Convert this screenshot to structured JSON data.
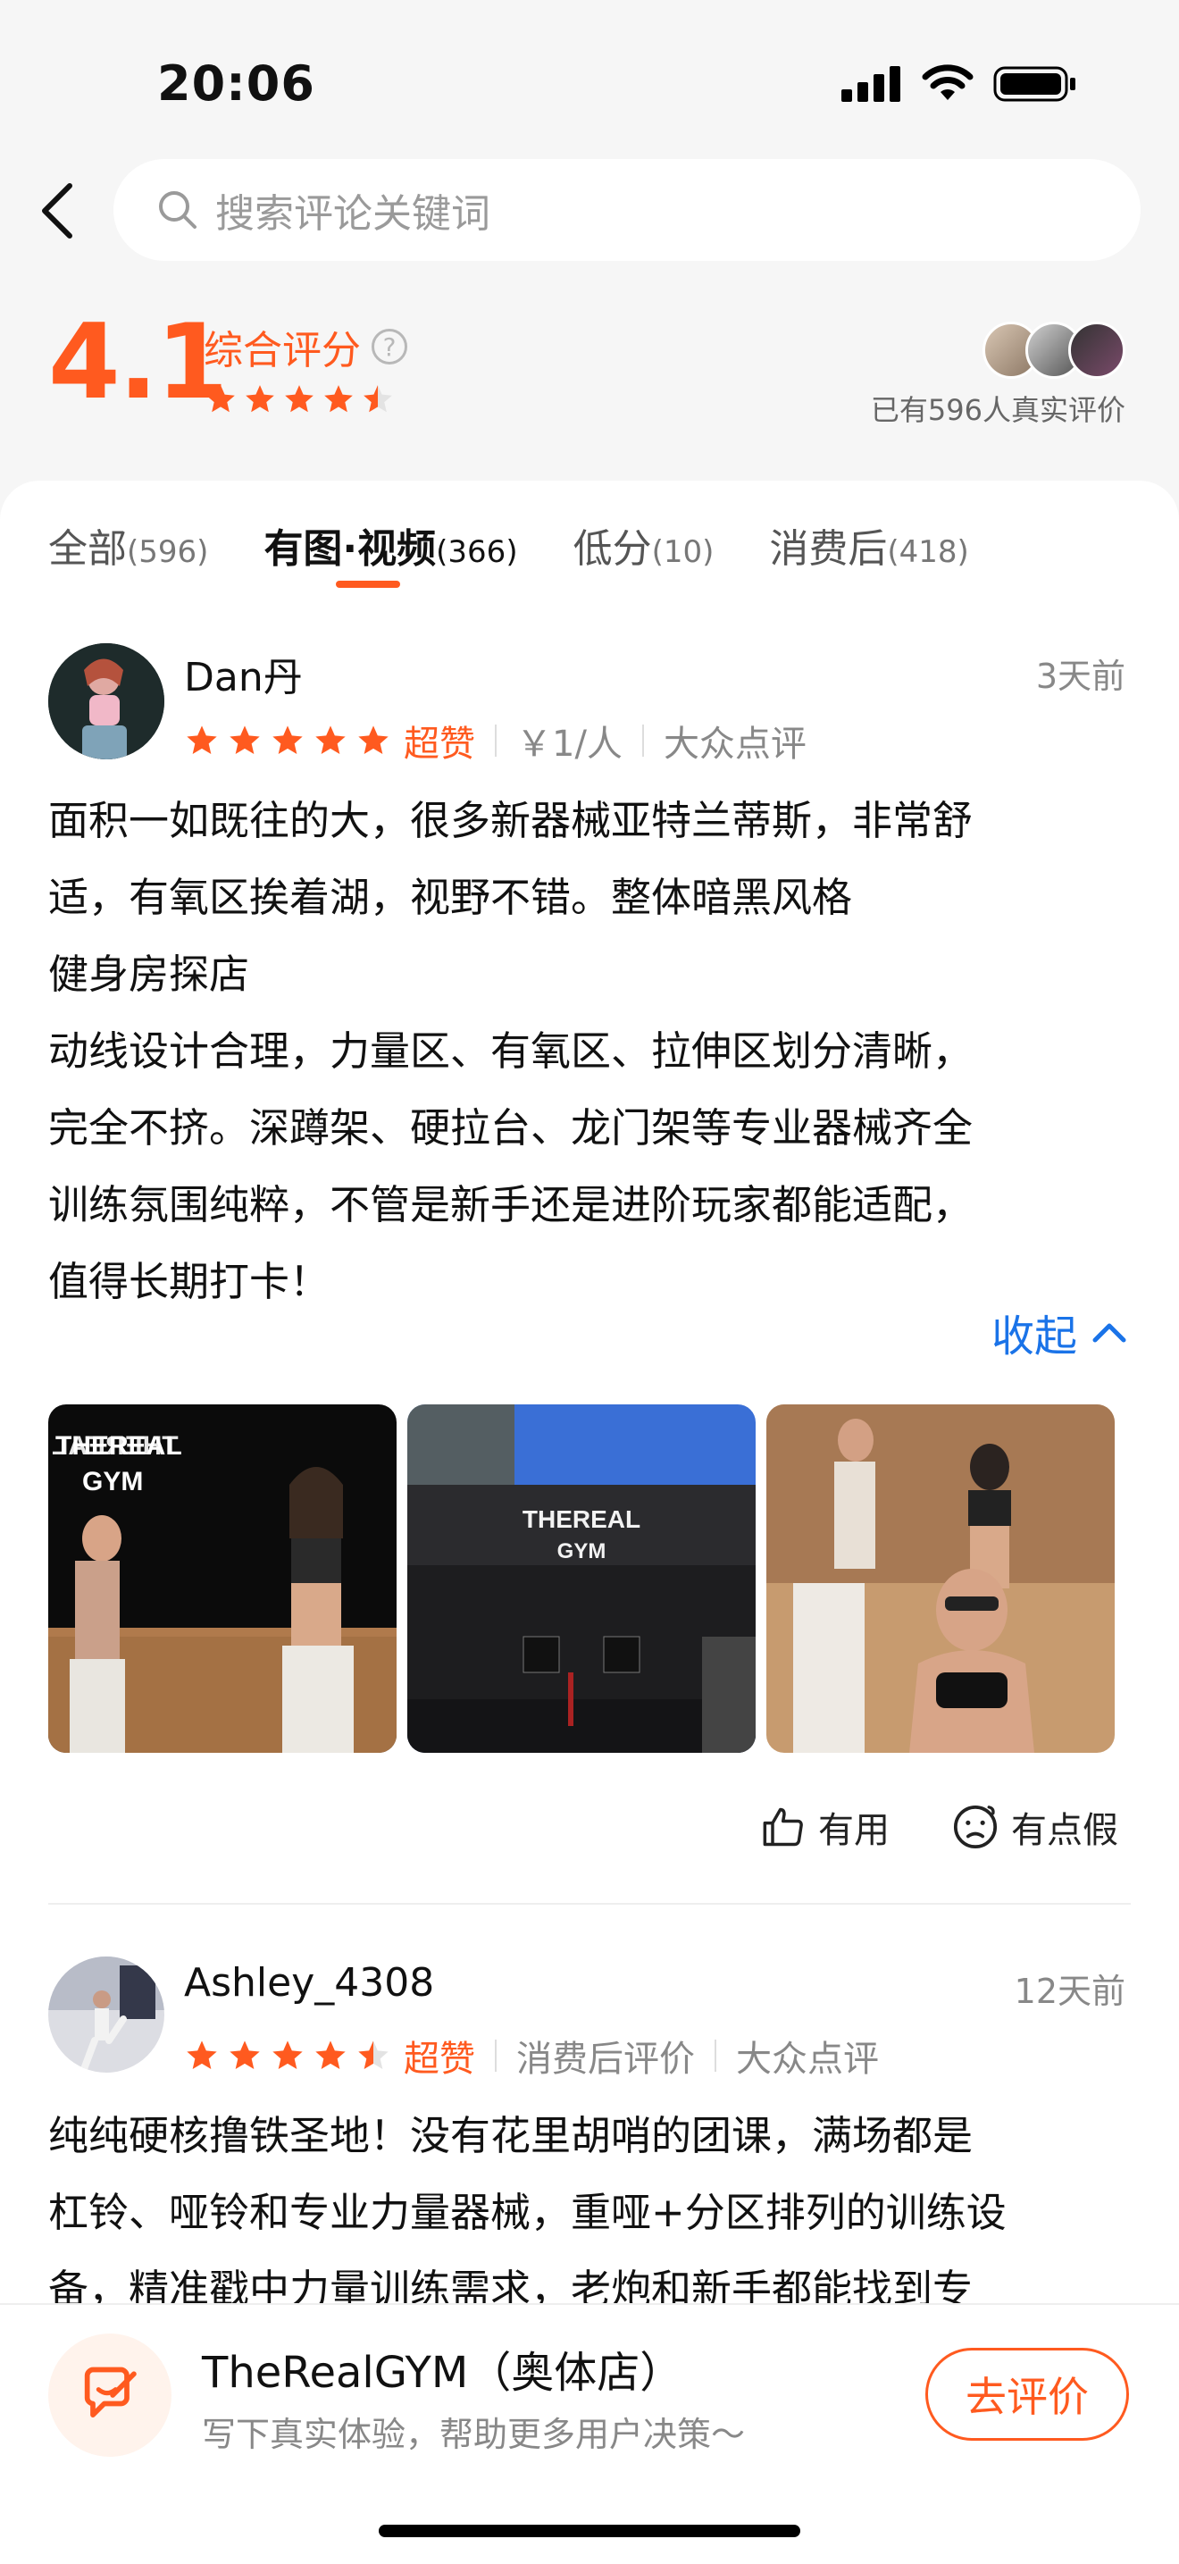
{
  "status": {
    "time": "20:06"
  },
  "search": {
    "placeholder": "搜索评论关键词"
  },
  "summary": {
    "rating": "4.1",
    "title": "综合评分",
    "help": "?",
    "note": "已有596人真实评价"
  },
  "tabs": [
    {
      "label": "全部",
      "count": "(596)"
    },
    {
      "label": "有图·视频",
      "count": "(366)"
    },
    {
      "label": "低分",
      "count": "(10)"
    },
    {
      "label": "消费后",
      "count": "(418)"
    }
  ],
  "reviews": [
    {
      "user": "Dan丹",
      "time": "3天前",
      "stars": 5,
      "badge": "超赞",
      "meta1": "￥1/人",
      "meta2": "大众点评",
      "lines": [
        "面积一如既往的大，很多新器械亚特兰蒂斯，非常舒",
        "适，有氧区挨着湖，视野不错。整体暗黑风格",
        "健身房探店",
        "动线设计合理，力量区、有氧区、拉伸区划分清晰，",
        "完全不挤。深蹲架、硬拉台、龙门架等专业器械齐全",
        "训练氛围纯粹，不管是新手还是进阶玩家都能适配，",
        "值得长期打卡！"
      ],
      "collapse": "收起",
      "photo_texts": [
        "THEREAL",
        "GYM",
        "THEREAL",
        "GYM"
      ],
      "useful": "有用",
      "fake": "有点假"
    },
    {
      "user": "Ashley_4308",
      "time": "12天前",
      "stars": 4.5,
      "badge": "超赞",
      "meta1": "消费后评价",
      "meta2": "大众点评",
      "lines": [
        "纯纯硬核撸铁圣地！没有花里胡哨的团课，满场都是",
        "杠铃、哑铃和专业力量器械，重哑+分区排列的训练设",
        "备，精准戳中力量训练需求，老炮和新手都能找到专"
      ]
    }
  ],
  "bottom": {
    "title": "TheRealGYM（奥体店）",
    "subtitle": "写下真实体验，帮助更多用户决策～",
    "button": "去评价"
  },
  "colors": {
    "accent": "#ff5a1f",
    "link": "#1a73e8"
  }
}
